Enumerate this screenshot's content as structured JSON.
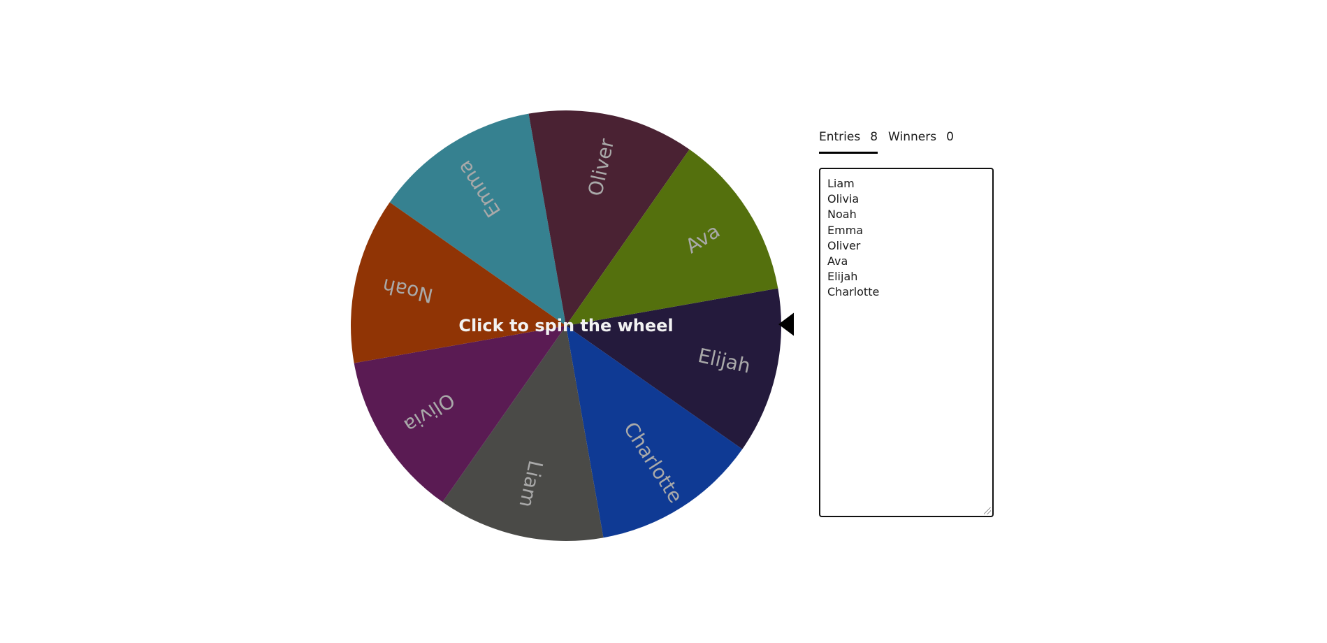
{
  "wheel": {
    "spin_prompt": "Click to spin the wheel",
    "segments": [
      {
        "label": "Elijah",
        "color": "#241a3c"
      },
      {
        "label": "Charlotte",
        "color": "#0f3a94"
      },
      {
        "label": "Liam",
        "color": "#4a4a47"
      },
      {
        "label": "Olivia",
        "color": "#5a1b53"
      },
      {
        "label": "Noah",
        "color": "#903405"
      },
      {
        "label": "Emma",
        "color": "#368190"
      },
      {
        "label": "Oliver",
        "color": "#4a2233"
      },
      {
        "label": "Ava",
        "color": "#54700d"
      }
    ],
    "label_color": "#a9a9a9",
    "pointer_color": "#000000"
  },
  "tabs": [
    {
      "label": "Entries",
      "count": "8"
    },
    {
      "label": "Winners",
      "count": "0"
    }
  ],
  "entries": [
    "Liam",
    "Olivia",
    "Noah",
    "Emma",
    "Oliver",
    "Ava",
    "Elijah",
    "Charlotte"
  ]
}
